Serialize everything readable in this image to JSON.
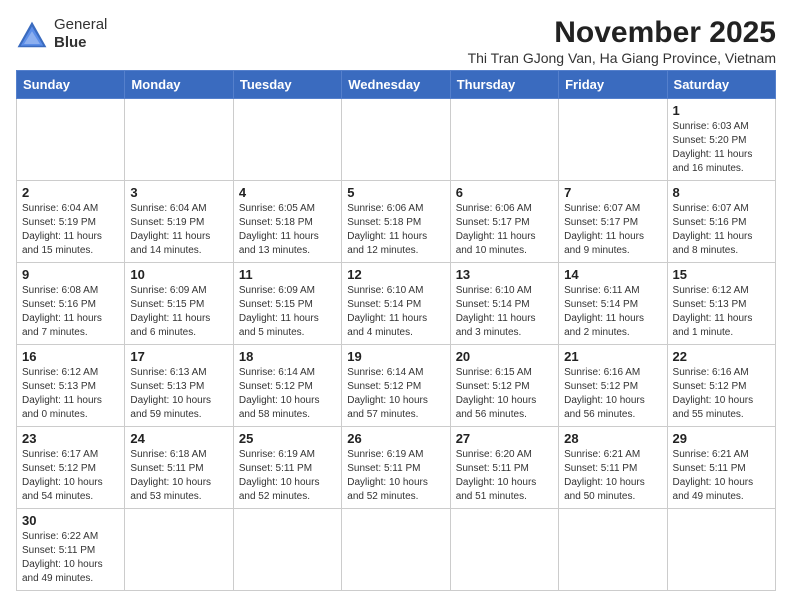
{
  "header": {
    "logo_line1": "General",
    "logo_line2": "Blue",
    "month_year": "November 2025",
    "subtitle": "Thi Tran GJong Van, Ha Giang Province, Vietnam"
  },
  "weekdays": [
    "Sunday",
    "Monday",
    "Tuesday",
    "Wednesday",
    "Thursday",
    "Friday",
    "Saturday"
  ],
  "weeks": [
    [
      {
        "day": "",
        "info": ""
      },
      {
        "day": "",
        "info": ""
      },
      {
        "day": "",
        "info": ""
      },
      {
        "day": "",
        "info": ""
      },
      {
        "day": "",
        "info": ""
      },
      {
        "day": "",
        "info": ""
      },
      {
        "day": "1",
        "info": "Sunrise: 6:03 AM\nSunset: 5:20 PM\nDaylight: 11 hours and 16 minutes."
      }
    ],
    [
      {
        "day": "2",
        "info": "Sunrise: 6:04 AM\nSunset: 5:19 PM\nDaylight: 11 hours and 15 minutes."
      },
      {
        "day": "3",
        "info": "Sunrise: 6:04 AM\nSunset: 5:19 PM\nDaylight: 11 hours and 14 minutes."
      },
      {
        "day": "4",
        "info": "Sunrise: 6:05 AM\nSunset: 5:18 PM\nDaylight: 11 hours and 13 minutes."
      },
      {
        "day": "5",
        "info": "Sunrise: 6:06 AM\nSunset: 5:18 PM\nDaylight: 11 hours and 12 minutes."
      },
      {
        "day": "6",
        "info": "Sunrise: 6:06 AM\nSunset: 5:17 PM\nDaylight: 11 hours and 10 minutes."
      },
      {
        "day": "7",
        "info": "Sunrise: 6:07 AM\nSunset: 5:17 PM\nDaylight: 11 hours and 9 minutes."
      },
      {
        "day": "8",
        "info": "Sunrise: 6:07 AM\nSunset: 5:16 PM\nDaylight: 11 hours and 8 minutes."
      }
    ],
    [
      {
        "day": "9",
        "info": "Sunrise: 6:08 AM\nSunset: 5:16 PM\nDaylight: 11 hours and 7 minutes."
      },
      {
        "day": "10",
        "info": "Sunrise: 6:09 AM\nSunset: 5:15 PM\nDaylight: 11 hours and 6 minutes."
      },
      {
        "day": "11",
        "info": "Sunrise: 6:09 AM\nSunset: 5:15 PM\nDaylight: 11 hours and 5 minutes."
      },
      {
        "day": "12",
        "info": "Sunrise: 6:10 AM\nSunset: 5:14 PM\nDaylight: 11 hours and 4 minutes."
      },
      {
        "day": "13",
        "info": "Sunrise: 6:10 AM\nSunset: 5:14 PM\nDaylight: 11 hours and 3 minutes."
      },
      {
        "day": "14",
        "info": "Sunrise: 6:11 AM\nSunset: 5:14 PM\nDaylight: 11 hours and 2 minutes."
      },
      {
        "day": "15",
        "info": "Sunrise: 6:12 AM\nSunset: 5:13 PM\nDaylight: 11 hours and 1 minute."
      }
    ],
    [
      {
        "day": "16",
        "info": "Sunrise: 6:12 AM\nSunset: 5:13 PM\nDaylight: 11 hours and 0 minutes."
      },
      {
        "day": "17",
        "info": "Sunrise: 6:13 AM\nSunset: 5:13 PM\nDaylight: 10 hours and 59 minutes."
      },
      {
        "day": "18",
        "info": "Sunrise: 6:14 AM\nSunset: 5:12 PM\nDaylight: 10 hours and 58 minutes."
      },
      {
        "day": "19",
        "info": "Sunrise: 6:14 AM\nSunset: 5:12 PM\nDaylight: 10 hours and 57 minutes."
      },
      {
        "day": "20",
        "info": "Sunrise: 6:15 AM\nSunset: 5:12 PM\nDaylight: 10 hours and 56 minutes."
      },
      {
        "day": "21",
        "info": "Sunrise: 6:16 AM\nSunset: 5:12 PM\nDaylight: 10 hours and 56 minutes."
      },
      {
        "day": "22",
        "info": "Sunrise: 6:16 AM\nSunset: 5:12 PM\nDaylight: 10 hours and 55 minutes."
      }
    ],
    [
      {
        "day": "23",
        "info": "Sunrise: 6:17 AM\nSunset: 5:12 PM\nDaylight: 10 hours and 54 minutes."
      },
      {
        "day": "24",
        "info": "Sunrise: 6:18 AM\nSunset: 5:11 PM\nDaylight: 10 hours and 53 minutes."
      },
      {
        "day": "25",
        "info": "Sunrise: 6:19 AM\nSunset: 5:11 PM\nDaylight: 10 hours and 52 minutes."
      },
      {
        "day": "26",
        "info": "Sunrise: 6:19 AM\nSunset: 5:11 PM\nDaylight: 10 hours and 52 minutes."
      },
      {
        "day": "27",
        "info": "Sunrise: 6:20 AM\nSunset: 5:11 PM\nDaylight: 10 hours and 51 minutes."
      },
      {
        "day": "28",
        "info": "Sunrise: 6:21 AM\nSunset: 5:11 PM\nDaylight: 10 hours and 50 minutes."
      },
      {
        "day": "29",
        "info": "Sunrise: 6:21 AM\nSunset: 5:11 PM\nDaylight: 10 hours and 49 minutes."
      }
    ],
    [
      {
        "day": "30",
        "info": "Sunrise: 6:22 AM\nSunset: 5:11 PM\nDaylight: 10 hours and 49 minutes."
      },
      {
        "day": "",
        "info": ""
      },
      {
        "day": "",
        "info": ""
      },
      {
        "day": "",
        "info": ""
      },
      {
        "day": "",
        "info": ""
      },
      {
        "day": "",
        "info": ""
      },
      {
        "day": "",
        "info": ""
      }
    ]
  ]
}
